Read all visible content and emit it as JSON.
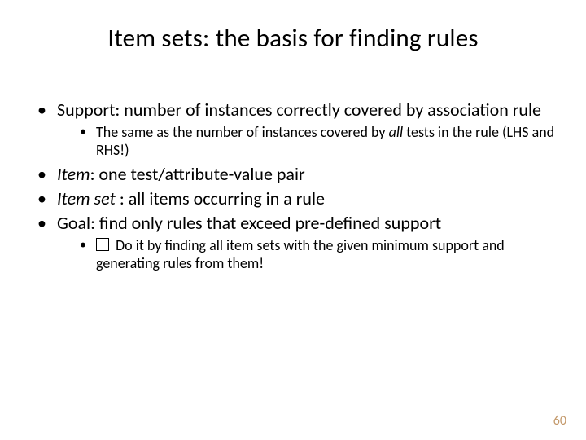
{
  "title": "Item sets: the basis for finding rules",
  "bullets": {
    "b1": {
      "text_a": "Support: number of instances correctly covered by association rule",
      "sub1_a": "The same as the number of instances covered by ",
      "sub1_b": "all",
      "sub1_c": " tests in the rule (LHS and RHS!)"
    },
    "b2": {
      "term": "Item",
      "rest": ": one test/attribute-value pair"
    },
    "b3": {
      "term": "Item set",
      "rest": " : all items occurring in a rule"
    },
    "b4": {
      "text": "Goal: find only rules that exceed pre-defined support",
      "sub1": " Do it by finding all item sets with the given minimum support and generating rules from them!"
    }
  },
  "page_number": "60"
}
